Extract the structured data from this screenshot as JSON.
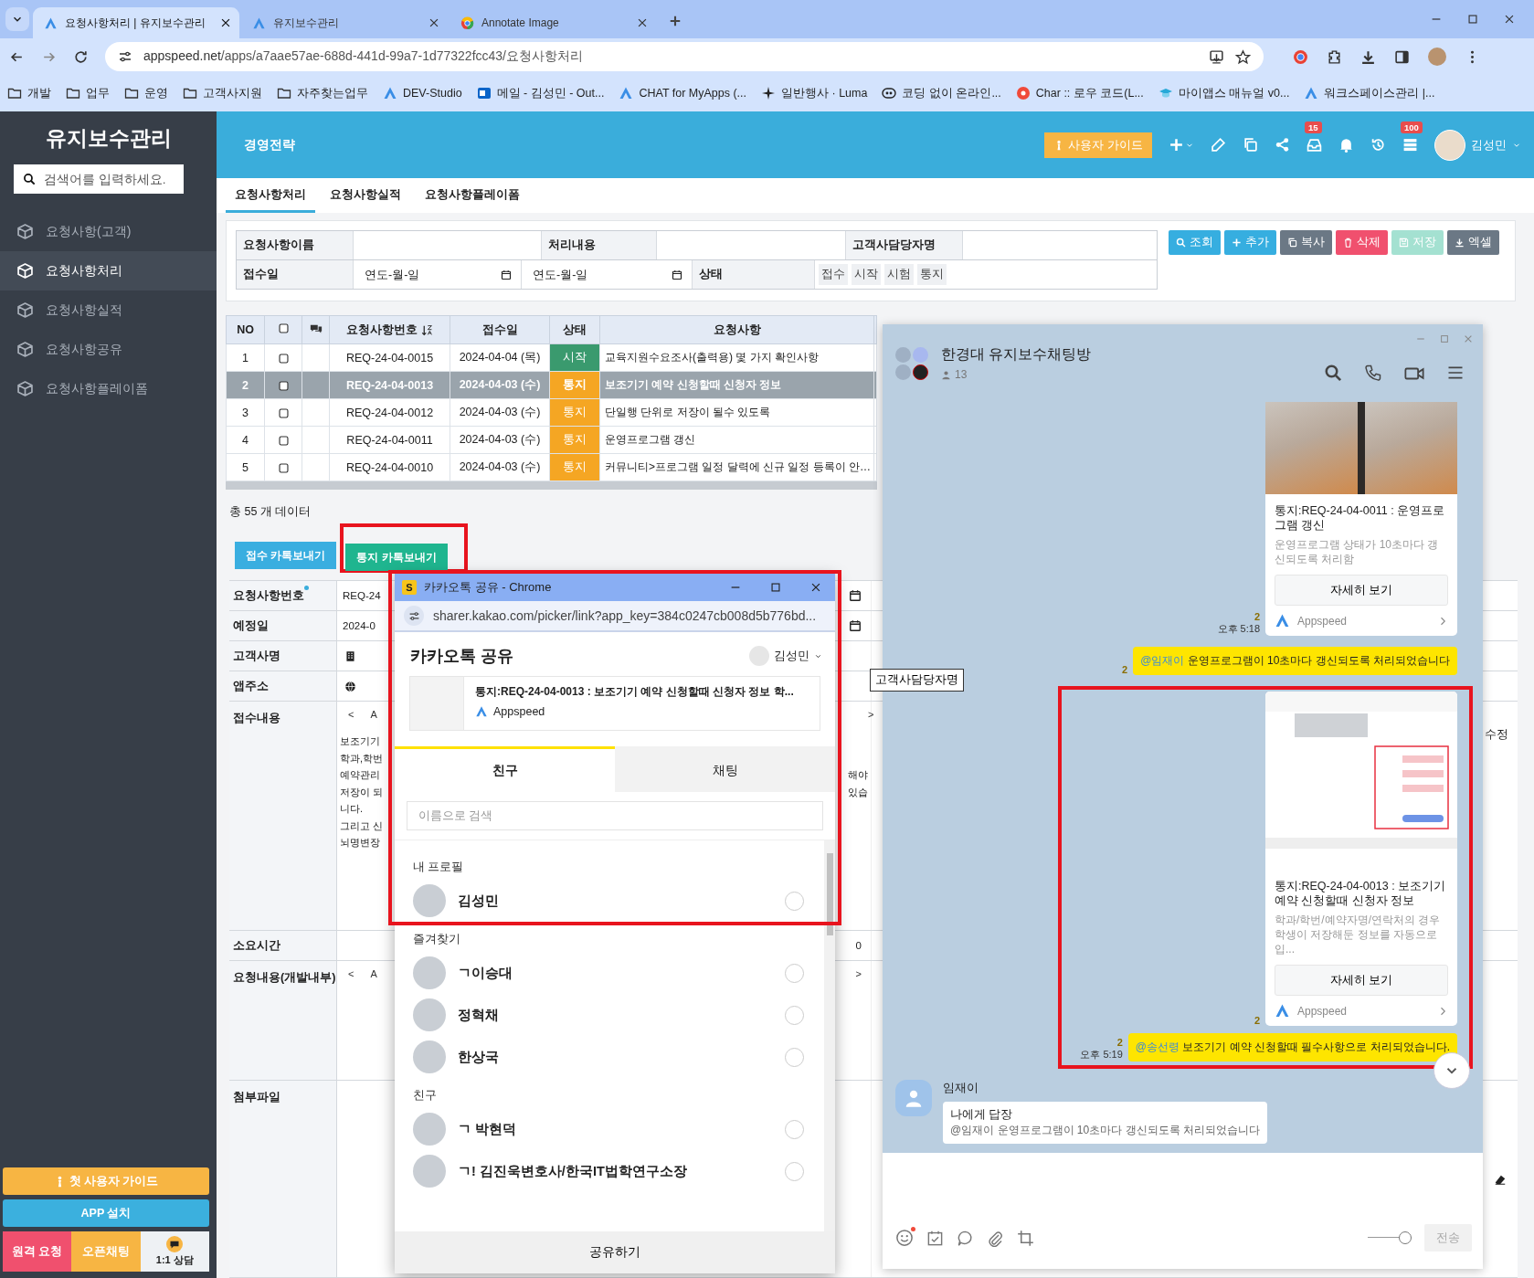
{
  "browser": {
    "tabs": [
      {
        "title": "요청사항처리 | 유지보수관리",
        "kind": "app",
        "selected": true
      },
      {
        "title": "유지보수관리",
        "kind": "app",
        "selected": false
      },
      {
        "title": "Annotate Image",
        "kind": "web",
        "selected": false
      }
    ],
    "url": {
      "host": "appspeed.net",
      "path": "/apps/a7aae57ae-688d-441d-99a7-1d77322fcc43/요청사항처리"
    },
    "bookmarks": [
      {
        "label": "개발",
        "kind": "folder"
      },
      {
        "label": "업무",
        "kind": "folder"
      },
      {
        "label": "운영",
        "kind": "folder"
      },
      {
        "label": "고객사지원",
        "kind": "folder"
      },
      {
        "label": "자주찾는업무",
        "kind": "folder"
      },
      {
        "label": "DEV-Studio",
        "kind": "logo"
      },
      {
        "label": "메일 - 김성민 - Out...",
        "kind": "mail"
      },
      {
        "label": "CHAT for MyApps (...",
        "kind": "logo"
      },
      {
        "label": "일반행사 · Luma",
        "kind": "spark"
      },
      {
        "label": "코딩 없이 온라인...",
        "kind": "nc"
      },
      {
        "label": "Char :: 로우 코드(L...",
        "kind": "char"
      },
      {
        "label": "마이앱스 매뉴얼 v0...",
        "kind": "cap"
      },
      {
        "label": "워크스페이스관리 |...",
        "kind": "logo"
      }
    ]
  },
  "sidebar": {
    "title": "유지보수관리",
    "search": {
      "placeholder": "검색어를 입력하세요."
    },
    "items": [
      {
        "label": "요청사항(고객)",
        "selected": false
      },
      {
        "label": "요청사항처리",
        "selected": true
      },
      {
        "label": "요청사항실적",
        "selected": false
      },
      {
        "label": "요청사항공유",
        "selected": false
      },
      {
        "label": "요청사항플레이폼",
        "selected": false
      }
    ],
    "buttons": [
      {
        "label": "첫 사용자 가이드",
        "kind": "guide"
      },
      {
        "label": "APP 설치",
        "kind": "install"
      },
      {
        "label": "원격 요청",
        "kind": "remote"
      },
      {
        "label": "오픈채팅",
        "kind": "openchat"
      },
      {
        "label": "1:1 상담",
        "kind": "consult"
      }
    ]
  },
  "header": {
    "title": "경영전략",
    "guide_button": "사용자 가이드",
    "inbox_badge": "15",
    "list_badge": "100",
    "user": "김성민"
  },
  "subtabs": [
    {
      "label": "요청사항처리",
      "selected": true
    },
    {
      "label": "요청사항실적",
      "selected": false
    },
    {
      "label": "요청사항플레이폼",
      "selected": false
    }
  ],
  "filter": {
    "name_label": "요청사항이름",
    "process_label": "처리내용",
    "manager_label": "고객사담당자명",
    "date_label": "접수일",
    "date_from": {
      "placeholder": "연도-월-일"
    },
    "date_to": {
      "placeholder": "연도-월-일"
    },
    "status_label": "상태",
    "status_options": [
      "접수",
      "시작",
      "시험",
      "통지"
    ]
  },
  "actions": [
    {
      "label": "조회",
      "kind": "search",
      "disabled": false
    },
    {
      "label": "추가",
      "kind": "add",
      "disabled": false
    },
    {
      "label": "복사",
      "kind": "copy",
      "disabled": false
    },
    {
      "label": "삭제",
      "kind": "delete",
      "disabled": false
    },
    {
      "label": "저장",
      "kind": "save",
      "disabled": true
    },
    {
      "label": "엑셀",
      "kind": "excel",
      "disabled": false
    }
  ],
  "table": {
    "columns": [
      "NO",
      "요청사항번호",
      "접수일",
      "상태",
      "요청사항"
    ],
    "select_all": false,
    "rows": [
      {
        "no": "1",
        "number": "REQ-24-04-0015",
        "date": "2024-04-04 (목)",
        "status": "시작",
        "color": "#3a9a6e",
        "request": "교육지원수요조사(출력용) 몇 가지 확인사항",
        "checked": false,
        "selected": false
      },
      {
        "no": "2",
        "number": "REQ-24-04-0013",
        "date": "2024-04-03 (수)",
        "status": "통지",
        "color": "#f5a623",
        "request": "보조기기 예약 신청할때 신청자 정보",
        "checked": false,
        "selected": true
      },
      {
        "no": "3",
        "number": "REQ-24-04-0012",
        "date": "2024-04-03 (수)",
        "status": "통지",
        "color": "#f5a623",
        "request": "단일행 단위로 저장이 될수 있도록",
        "checked": false,
        "selected": false
      },
      {
        "no": "4",
        "number": "REQ-24-04-0011",
        "date": "2024-04-03 (수)",
        "status": "통지",
        "color": "#f5a623",
        "request": "운영프로그램 갱신",
        "checked": false,
        "selected": false
      },
      {
        "no": "5",
        "number": "REQ-24-04-0010",
        "date": "2024-04-03 (수)",
        "status": "통지",
        "color": "#f5a623",
        "request": "커뮤니티>프로그램 일정 달력에 신규 일정 등록이 안…",
        "checked": false,
        "selected": false
      }
    ]
  },
  "summary": "총 55 개 데이터",
  "send_buttons": [
    {
      "label": "접수 카톡보내기",
      "color": "#3aaee0",
      "highlighted": false
    },
    {
      "label": "통지 카톡보내기",
      "color": "#1fb58f",
      "highlighted": true
    }
  ],
  "form": {
    "rows": [
      {
        "label": "요청사항번호",
        "kind": "text",
        "required": true,
        "value": "REQ-24"
      },
      {
        "label": "예정일",
        "kind": "date",
        "required": false,
        "value": "2024-0"
      },
      {
        "label": "고객사명",
        "kind": "company",
        "required": false
      },
      {
        "label": "앱주소",
        "kind": "url",
        "required": false
      },
      {
        "label": "접수내용",
        "kind": "editor",
        "required": false,
        "toolbar": [
          "<",
          "A"
        ],
        "toolbar_end": ">",
        "lines": [
          {
            "left": "보조기기"
          },
          {
            "left": "학과,학번"
          },
          {
            "left": "예약관리",
            "right": "해야"
          },
          {
            "left": "저장이 되",
            "right": "있습"
          },
          {
            "left": "니다."
          },
          {
            "left": "그리고 신"
          },
          {
            "left": "뇌명변장"
          }
        ],
        "far_right": "수정"
      },
      {
        "label": "소요시간",
        "kind": "number",
        "required": false,
        "value": "0"
      },
      {
        "label": "요청내용(개발내부)",
        "kind": "editor",
        "required": false,
        "toolbar": [
          "<",
          "A"
        ],
        "toolbar_end": ">"
      },
      {
        "label": "첨부파일",
        "kind": "file",
        "required": false
      }
    ]
  },
  "share_popup": {
    "app_badge": "S",
    "window_title": "카카오톡 공유 - Chrome",
    "url": "sharer.kakao.com/picker/link?app_key=384c0247cb008d5b776bd...",
    "heading": "카카오톡 공유",
    "account": "김성민",
    "preview": {
      "title": "통지:REQ-24-04-0013 : 보조기기 예약 신청할때 신청자 정보 학...",
      "app": "Appspeed"
    },
    "tabs": [
      {
        "label": "친구",
        "selected": true
      },
      {
        "label": "채팅",
        "selected": false
      }
    ],
    "search": {
      "placeholder": "이름으로 검색"
    },
    "sections": [
      {
        "title": "내 프로필",
        "people": [
          {
            "name": "김성민",
            "checked": false
          }
        ]
      },
      {
        "title": "즐겨찾기",
        "people": [
          {
            "name": "ㄱ이승대",
            "checked": false
          },
          {
            "name": "정혁채",
            "checked": false
          },
          {
            "name": "한상국",
            "checked": false
          }
        ]
      },
      {
        "title": "친구",
        "people": [
          {
            "name": "ㄱ 박현덕",
            "checked": false
          },
          {
            "name": "ㄱ! 김진욱변호사/한국IT법학연구소장",
            "checked": false
          }
        ]
      }
    ],
    "share_button": "공유하기"
  },
  "chat": {
    "title": "한경대 유지보수채팅방",
    "members": "13",
    "messages": [
      {
        "kind": "card",
        "highlighted": false,
        "title": "통지:REQ-24-04-0011 : 운영프로그램 갱신",
        "description": "운영프로그램 상태가 10초마다 갱신되도록 처리함",
        "button": "자세히 보기",
        "app": "Appspeed",
        "unread": "2",
        "time": "오후 5:18"
      },
      {
        "kind": "bubble",
        "highlighted": false,
        "mention": "@임재이",
        "text": "운영프로그램이 10초마다 갱신되도록 처리되었습니다",
        "unread": "2"
      },
      {
        "kind": "card",
        "highlighted": true,
        "title": "통지:REQ-24-04-0013 : 보조기기 예약 신청할때 신청자 정보",
        "description": "학과/학번/예약자명/연락처의 경우 학생이 저장해둔 정보를 자동으로 입...",
        "button": "자세히 보기",
        "app": "Appspeed",
        "unread": "2"
      },
      {
        "kind": "bubble",
        "highlighted": true,
        "mention": "@송선령",
        "text": "보조기기 예약 신청할때 필수사항으로 처리되었습니다.",
        "unread": "2",
        "time": "오후 5:19"
      },
      {
        "kind": "incoming",
        "highlighted": false,
        "sender": "임재이",
        "reply_label": "나에게 답장",
        "quote": "@임재이 운영프로그램이 10초마다 갱신되도록 처리되었습니다"
      }
    ],
    "slider": {
      "level": 1
    },
    "send_button": "전송"
  },
  "tooltip": "고객사담당자명"
}
